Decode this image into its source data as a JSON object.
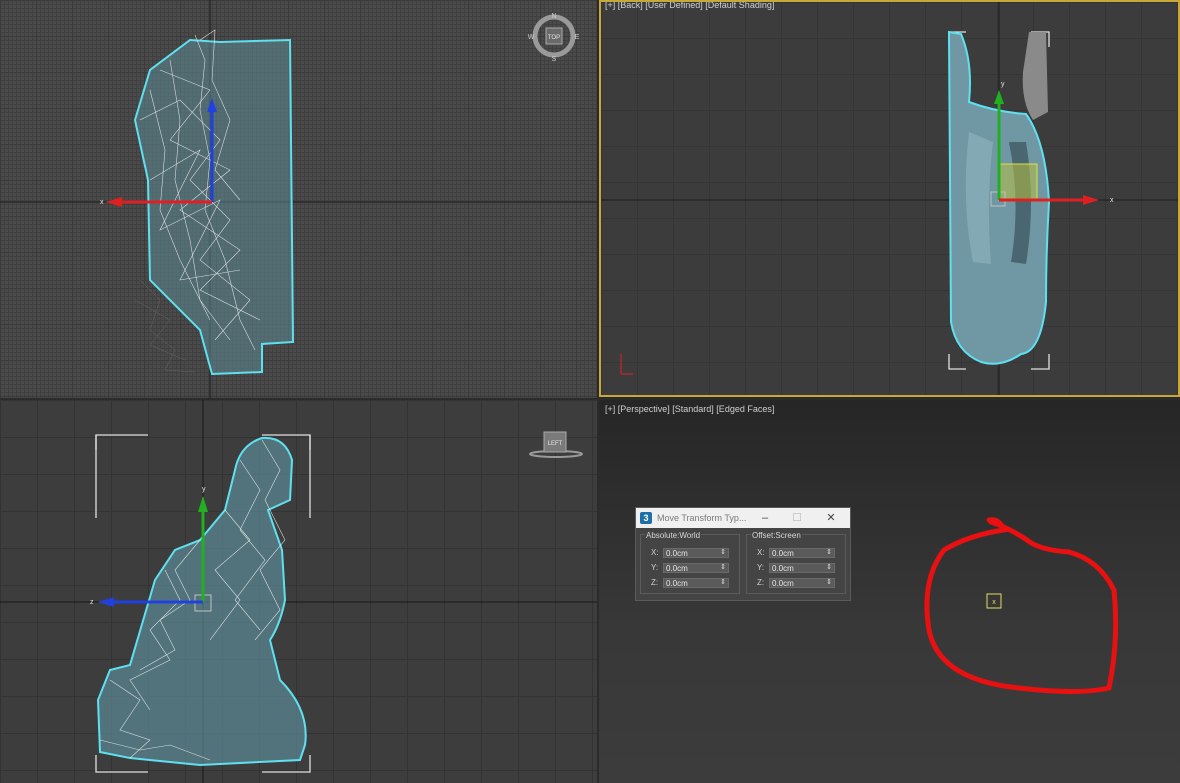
{
  "viewports": {
    "top_right_label": "[+] [Back] [User Defined] [Default Shading]",
    "bottom_right_label": "[+] [Perspective] [Standard] [Edged Faces]",
    "viewcube_top_left": "TOP",
    "viewcube_bottom_left": "LEFT",
    "compass": {
      "n": "N",
      "s": "S",
      "e": "E",
      "w": "W"
    },
    "axis_labels": {
      "x": "x",
      "y": "y",
      "z": "z"
    }
  },
  "dialog": {
    "title": "Move Transform Typ...",
    "app_icon": "3",
    "minimize": "–",
    "maximize": "☐",
    "close": "✕",
    "absolute": {
      "title": "Absolute:World",
      "x_label": "X:",
      "x_value": "0.0cm",
      "y_label": "Y:",
      "y_value": "0.0cm",
      "z_label": "Z:",
      "z_value": "0.0cm"
    },
    "offset": {
      "title": "Offset:Screen",
      "x_label": "X:",
      "x_value": "0.0cm",
      "y_label": "Y:",
      "y_value": "0.0cm",
      "z_label": "Z:",
      "z_value": "0.0cm"
    }
  },
  "colors": {
    "selection_outline": "#5fe0f0",
    "active_viewport_border": "#c8a838",
    "annotation_red": "#e81010",
    "gizmo_x": "#e02020",
    "gizmo_y": "#20b020",
    "gizmo_z": "#2040e0"
  },
  "icons": [
    "viewcube-icon",
    "compass-icon",
    "move-gizmo-icon",
    "pivot-marker-icon"
  ]
}
